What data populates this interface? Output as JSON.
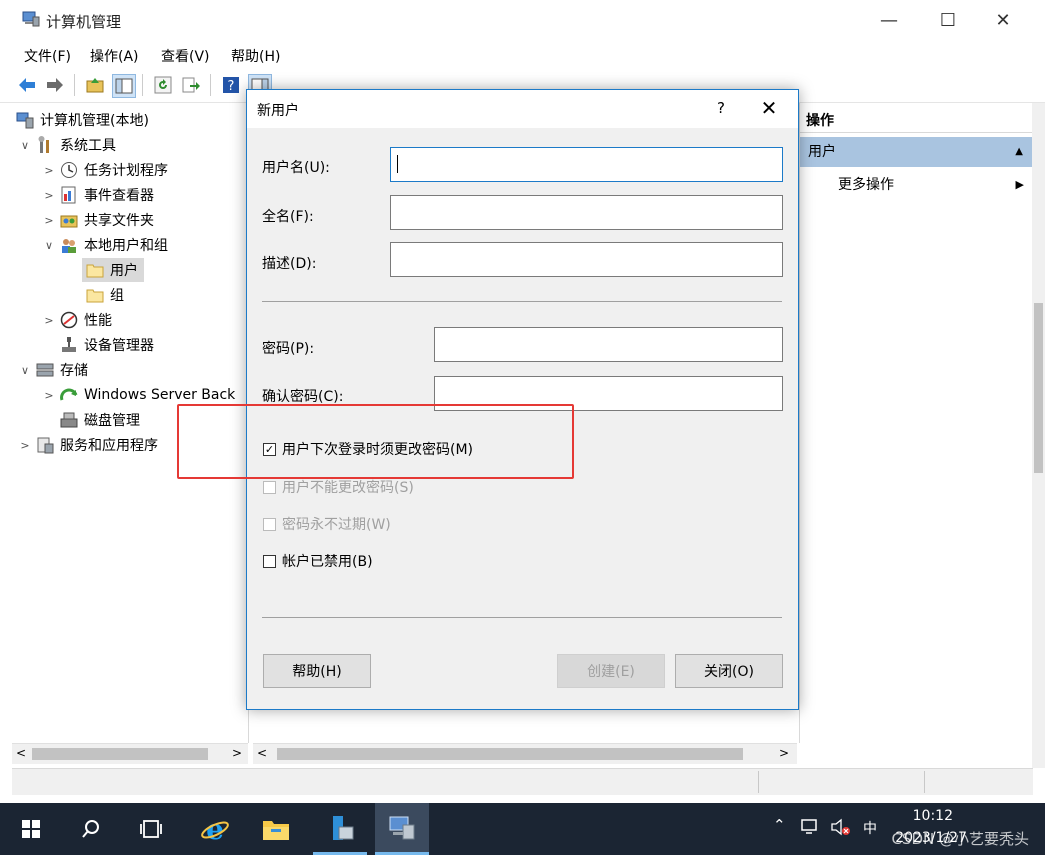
{
  "window": {
    "title": "计算机管理",
    "controls": {
      "minimize": "—",
      "maximize": "☐",
      "close": "✕"
    }
  },
  "menu": [
    "文件(F)",
    "操作(A)",
    "查看(V)",
    "帮助(H)"
  ],
  "tree": [
    {
      "label": "计算机管理(本地)",
      "expander": "",
      "icon": "computer-management-icon"
    },
    {
      "label": "系统工具",
      "expander": "∨",
      "icon": "tools-icon"
    },
    {
      "label": "任务计划程序",
      "expander": ">",
      "icon": "clock-icon"
    },
    {
      "label": "事件查看器",
      "expander": ">",
      "icon": "event-viewer-icon"
    },
    {
      "label": "共享文件夹",
      "expander": ">",
      "icon": "shared-folder-icon"
    },
    {
      "label": "本地用户和组",
      "expander": "∨",
      "icon": "users-icon"
    },
    {
      "label": "用户",
      "expander": "",
      "icon": "folder-icon"
    },
    {
      "label": "组",
      "expander": "",
      "icon": "folder-icon"
    },
    {
      "label": "性能",
      "expander": ">",
      "icon": "performance-icon"
    },
    {
      "label": "设备管理器",
      "expander": "",
      "icon": "device-manager-icon"
    },
    {
      "label": "存储",
      "expander": "∨",
      "icon": "storage-icon"
    },
    {
      "label": "Windows Server Back",
      "expander": ">",
      "icon": "backup-icon"
    },
    {
      "label": "磁盘管理",
      "expander": "",
      "icon": "disk-icon"
    },
    {
      "label": "服务和应用程序",
      "expander": ">",
      "icon": "services-icon"
    }
  ],
  "actions": {
    "header": "操作",
    "section": "用户",
    "more": "更多操作"
  },
  "dialog": {
    "title": "新用户",
    "help": "?",
    "close": "✕",
    "username_label": "用户名(U):",
    "fullname_label": "全名(F):",
    "description_label": "描述(D):",
    "password_label": "密码(P):",
    "confirm_label": "确认密码(C):",
    "chk_must_change": "用户下次登录时须更改密码(M)",
    "chk_cannot_change": "用户不能更改密码(S)",
    "chk_never_expires": "密码永不过期(W)",
    "chk_disabled": "帐户已禁用(B)",
    "btn_help": "帮助(H)",
    "btn_create": "创建(E)",
    "btn_close": "关闭(O)"
  },
  "taskbar": {
    "time": "10:12",
    "date": "2023/1/27",
    "ime": "中",
    "watermark": "CSDN @小艺要秃头"
  }
}
